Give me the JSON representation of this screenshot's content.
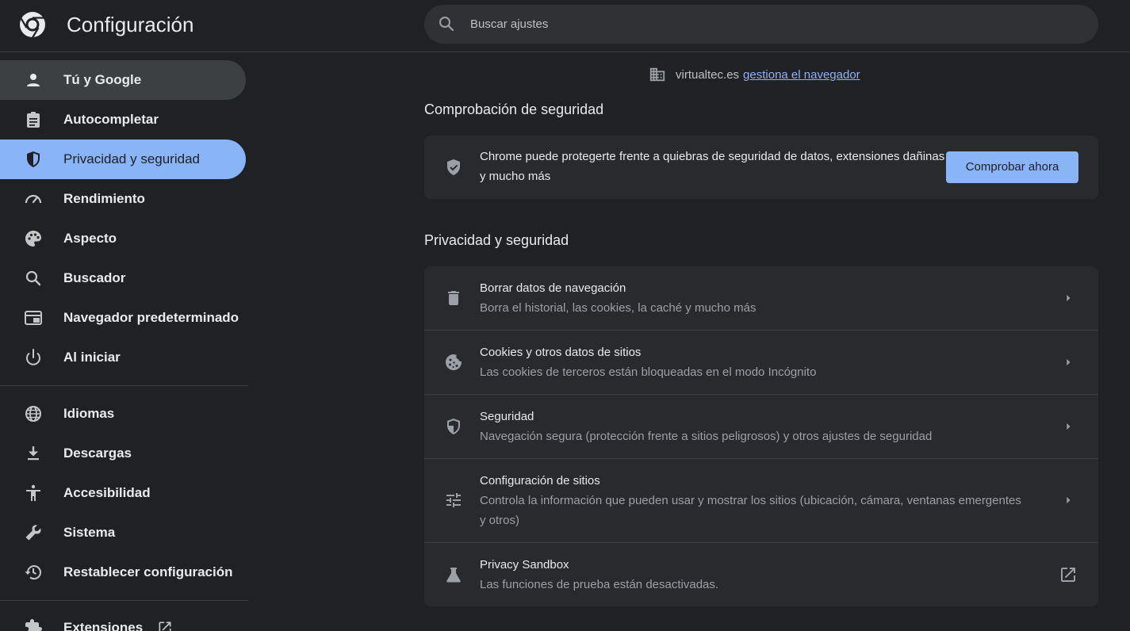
{
  "header": {
    "title": "Configuración",
    "search_placeholder": "Buscar ajustes"
  },
  "sidebar": {
    "items": [
      {
        "label": "Tú y Google",
        "icon": "person-icon"
      },
      {
        "label": "Autocompletar",
        "icon": "clipboard-icon"
      },
      {
        "label": "Privacidad y seguridad",
        "icon": "shield-icon"
      },
      {
        "label": "Rendimiento",
        "icon": "speedometer-icon"
      },
      {
        "label": "Aspecto",
        "icon": "palette-icon"
      },
      {
        "label": "Buscador",
        "icon": "search-icon"
      },
      {
        "label": "Navegador predeterminado",
        "icon": "browser-window-icon"
      },
      {
        "label": "Al iniciar",
        "icon": "power-icon"
      },
      {
        "label": "Idiomas",
        "icon": "globe-icon"
      },
      {
        "label": "Descargas",
        "icon": "download-icon"
      },
      {
        "label": "Accesibilidad",
        "icon": "accessibility-icon"
      },
      {
        "label": "Sistema",
        "icon": "wrench-icon"
      },
      {
        "label": "Restablecer configuración",
        "icon": "restore-icon"
      },
      {
        "label": "Extensiones",
        "icon": "puzzle-icon"
      }
    ]
  },
  "managed": {
    "domain": "virtualtec.es",
    "link": "gestiona el navegador"
  },
  "safety_check": {
    "section_title": "Comprobación de seguridad",
    "text": "Chrome puede protegerte frente a quiebras de seguridad de datos, extensiones dañinas y mucho más",
    "button": "Comprobar ahora"
  },
  "privacy": {
    "section_title": "Privacidad y seguridad",
    "rows": [
      {
        "title": "Borrar datos de navegación",
        "subtitle": "Borra el historial, las cookies, la caché y mucho más",
        "icon": "trash-icon"
      },
      {
        "title": "Cookies y otros datos de sitios",
        "subtitle": "Las cookies de terceros están bloqueadas en el modo Incógnito",
        "icon": "cookie-icon"
      },
      {
        "title": "Seguridad",
        "subtitle": "Navegación segura (protección frente a sitios peligrosos) y otros ajustes de seguridad",
        "icon": "shield-icon"
      },
      {
        "title": "Configuración de sitios",
        "subtitle": "Controla la información que pueden usar y mostrar los sitios (ubicación, cámara, ventanas emergentes y otros)",
        "icon": "sliders-icon"
      },
      {
        "title": "Privacy Sandbox",
        "subtitle": "Las funciones de prueba están desactivadas.",
        "icon": "flask-icon"
      }
    ]
  },
  "colors": {
    "background": "#202124",
    "card": "#292a2d",
    "accent": "#8ab4f8",
    "text": "#e8eaed",
    "secondary_text": "#9aa0a6"
  }
}
